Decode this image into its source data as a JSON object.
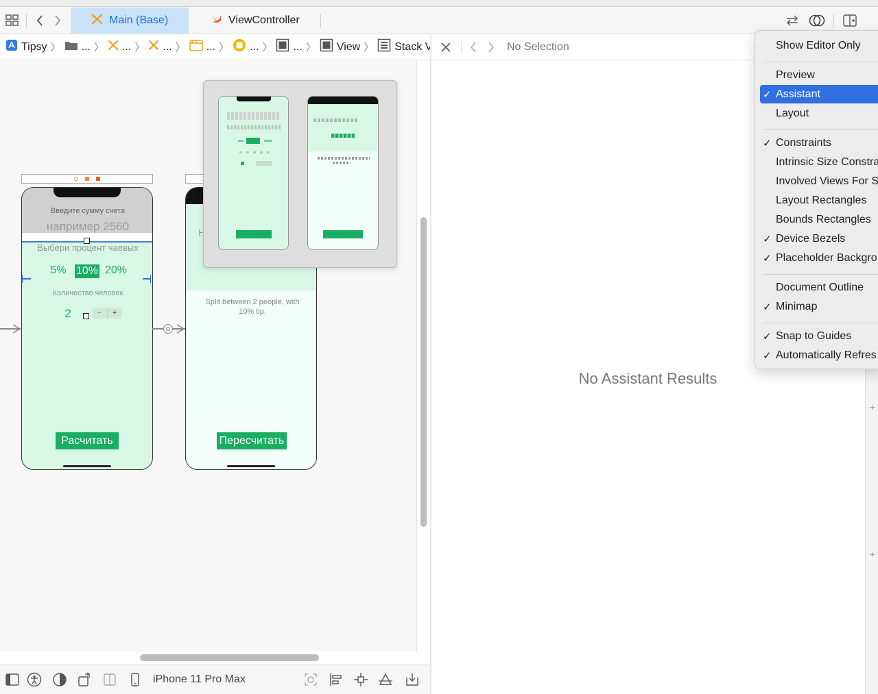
{
  "tabs": [
    {
      "label": "Main (Base)",
      "active": true,
      "icon": "storyboard-icon"
    },
    {
      "label": "ViewController",
      "active": false,
      "icon": "swift-icon"
    }
  ],
  "breadcrumb": {
    "project": "Tipsy",
    "ellipsis": "...",
    "view": "View",
    "stack_view": "Stack View"
  },
  "assistant": {
    "no_selection": "No Selection",
    "no_results": "No Assistant Results"
  },
  "scene1": {
    "prompt": "Введите сумму счета",
    "placeholder": "например 2560",
    "tip_label": "Выбери процент чаевых",
    "tip_options": [
      "5%",
      "10%",
      "20%"
    ],
    "selected_tip": "10%",
    "people_label": "Количество человек",
    "people_value": "2",
    "stepper_minus": "−",
    "stepper_plus": "+",
    "button": "Расчитать"
  },
  "scene2": {
    "truncated_letter": "H",
    "split_text": "Split between 2 people, with 10% tip.",
    "button": "Пересчитать"
  },
  "menu": {
    "items": [
      {
        "label": "Show Editor Only",
        "checked": false,
        "highlighted": false
      },
      {
        "label": "Preview",
        "checked": false,
        "highlighted": false
      },
      {
        "label": "Assistant",
        "checked": true,
        "highlighted": true
      },
      {
        "label": "Layout",
        "checked": false,
        "highlighted": false
      },
      {
        "label": "Constraints",
        "checked": true,
        "highlighted": false
      },
      {
        "label": "Intrinsic Size Constra",
        "checked": false,
        "highlighted": false
      },
      {
        "label": "Involved Views For S",
        "checked": false,
        "highlighted": false
      },
      {
        "label": "Layout Rectangles",
        "checked": false,
        "highlighted": false
      },
      {
        "label": "Bounds Rectangles",
        "checked": false,
        "highlighted": false
      },
      {
        "label": "Device Bezels",
        "checked": true,
        "highlighted": false
      },
      {
        "label": "Placeholder Backgro",
        "checked": true,
        "highlighted": false
      },
      {
        "label": "Document Outline",
        "checked": false,
        "highlighted": false
      },
      {
        "label": "Minimap",
        "checked": true,
        "highlighted": false
      },
      {
        "label": "Snap to Guides",
        "checked": true,
        "highlighted": false
      },
      {
        "label": "Automatically Refres",
        "checked": true,
        "highlighted": false
      }
    ],
    "checkmark": "✓"
  },
  "bottom": {
    "device": "iPhone 11 Pro Max"
  },
  "colors": {
    "accent_blue": "#1d6fd6",
    "tab_active_bg": "#c9e2f8",
    "scene_green": "#d9f7e6",
    "button_green": "#1aae62",
    "menu_highlight": "#2f6fe0"
  }
}
